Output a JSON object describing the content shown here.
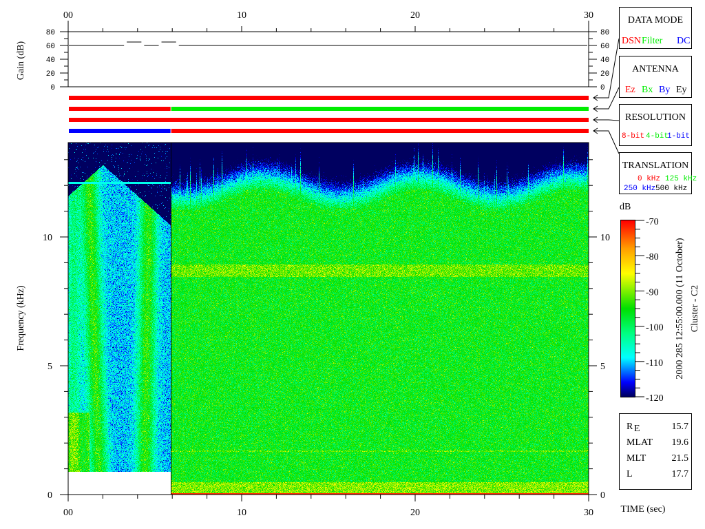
{
  "chart_data": [
    {
      "type": "line",
      "panel": "gain",
      "ylabel": "Gain (dB)",
      "ylim": [
        0,
        80
      ],
      "yticks": [
        "0",
        "20",
        "40",
        "60",
        "80"
      ],
      "xlim": [
        0,
        30
      ],
      "xticks": [
        "00",
        "10",
        "20",
        "30"
      ],
      "points": [
        [
          0,
          60
        ],
        [
          3.3,
          60
        ],
        [
          3.3,
          65
        ],
        [
          4.3,
          65
        ],
        [
          4.3,
          60
        ],
        [
          5.3,
          60
        ],
        [
          5.3,
          65
        ],
        [
          6.3,
          65
        ],
        [
          6.3,
          60
        ],
        [
          30,
          60
        ]
      ]
    },
    {
      "type": "status-bars",
      "rows": [
        {
          "label": "DATA MODE",
          "segments": [
            {
              "from": 0,
              "to": 30,
              "color": "#ff0000",
              "value": "DSN"
            }
          ]
        },
        {
          "label": "ANTENNA",
          "segments": [
            {
              "from": 0,
              "to": 5.9,
              "color": "#ff0000",
              "value": "Ez"
            },
            {
              "from": 5.9,
              "to": 30,
              "color": "#00ee00",
              "value": "Bx"
            }
          ]
        },
        {
          "label": "RESOLUTION",
          "segments": [
            {
              "from": 0,
              "to": 30,
              "color": "#ff0000",
              "value": "8-bit"
            }
          ]
        },
        {
          "label": "TRANSLATION",
          "segments": [
            {
              "from": 0,
              "to": 5.9,
              "color": "#0000ff",
              "value": "250 kHz"
            },
            {
              "from": 5.9,
              "to": 30,
              "color": "#ff0000",
              "value": "0 kHz"
            }
          ]
        }
      ]
    },
    {
      "type": "heatmap",
      "panel": "spectrogram",
      "xlabel": "TIME (sec)",
      "ylabel": "Frequency (kHz)",
      "xlim": [
        0,
        30
      ],
      "ylim": [
        0,
        13.66
      ],
      "xticks": [
        "00",
        "10",
        "20",
        "30"
      ],
      "yticks": [
        "0",
        "5",
        "10"
      ],
      "mode_change_time": 5.9,
      "colorbar": {
        "label": "dB",
        "range": [
          -120,
          -70
        ],
        "ticks": [
          "-70",
          "-80",
          "-90",
          "-100",
          "-110",
          "-120"
        ],
        "stops": [
          [
            -120,
            "#000060"
          ],
          [
            -116,
            "#0000ff"
          ],
          [
            -109,
            "#00ffff"
          ],
          [
            -102,
            "#00ff80"
          ],
          [
            -95,
            "#00e000"
          ],
          [
            -85,
            "#ffff00"
          ],
          [
            -78,
            "#ffa000"
          ],
          [
            -70,
            "#ff0000"
          ]
        ]
      }
    }
  ],
  "legend": {
    "data_mode": {
      "title": "DATA MODE",
      "items": [
        {
          "text": "DSN",
          "color": "#ff0000"
        },
        {
          "text": "Filter",
          "color": "#00ee00"
        },
        {
          "text": "DC",
          "color": "#0000ff"
        }
      ]
    },
    "antenna": {
      "title": "ANTENNA",
      "items": [
        {
          "text": "Ez",
          "color": "#ff0000"
        },
        {
          "text": "Bx",
          "color": "#00ee00"
        },
        {
          "text": "By",
          "color": "#0000ff"
        },
        {
          "text": "Ey",
          "color": "#000000"
        }
      ]
    },
    "resolution": {
      "title": "RESOLUTION",
      "items": [
        {
          "text": "8-bit",
          "color": "#ff0000"
        },
        {
          "text": "4-bit",
          "color": "#00ee00"
        },
        {
          "text": "1-bit",
          "color": "#0000ff"
        }
      ]
    },
    "translation": {
      "title": "TRANSLATION",
      "items": [
        {
          "text": "0 kHz",
          "color": "#ff0000"
        },
        {
          "text": "125 kHz",
          "color": "#00ee00"
        },
        {
          "text": "250 kHz",
          "color": "#0000ff"
        },
        {
          "text": "500 kHz",
          "color": "#000000"
        }
      ]
    }
  },
  "side_title": {
    "line1": "2000 285 12:55:00.000 (11 October)",
    "line2": "Cluster - C2"
  },
  "orbit": [
    {
      "label": "R",
      "sub": "E",
      "value": "15.7"
    },
    {
      "label": "MLAT",
      "sub": "",
      "value": "19.6"
    },
    {
      "label": "MLT",
      "sub": "",
      "value": "21.5"
    },
    {
      "label": "L",
      "sub": "",
      "value": "17.7"
    }
  ]
}
